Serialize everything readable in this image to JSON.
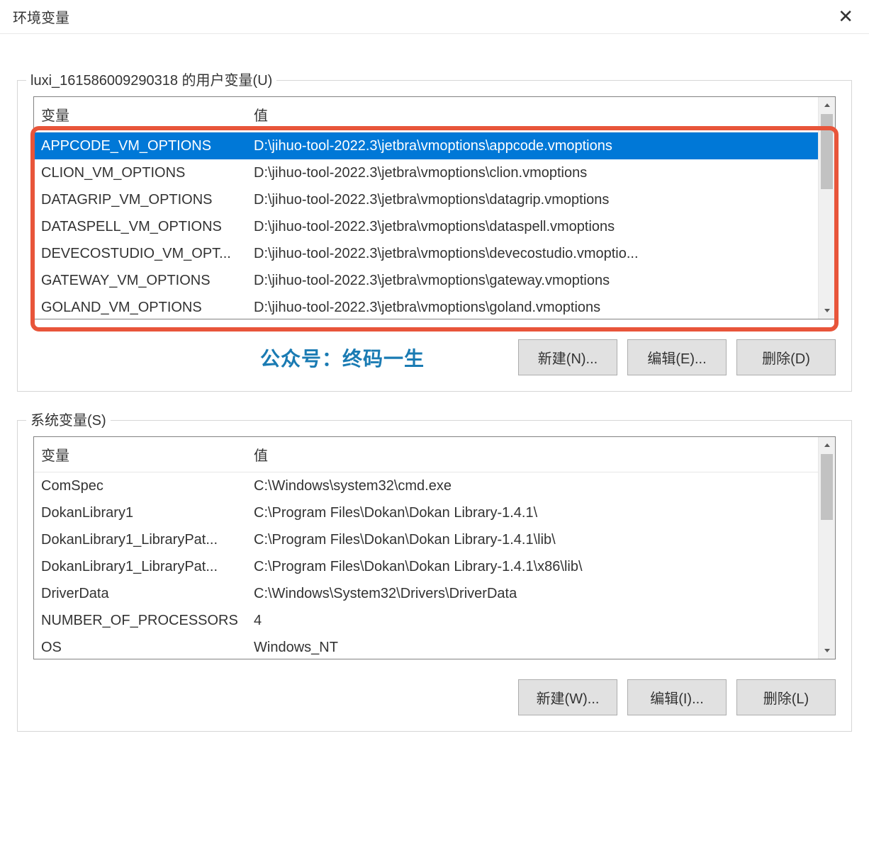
{
  "title": "环境变量",
  "user_section": {
    "legend": "luxi_161586009290318 的用户变量(U)",
    "columns": {
      "var": "变量",
      "val": "值"
    },
    "rows": [
      {
        "var": "APPCODE_VM_OPTIONS",
        "val": "D:\\jihuo-tool-2022.3\\jetbra\\vmoptions\\appcode.vmoptions",
        "selected": true
      },
      {
        "var": "CLION_VM_OPTIONS",
        "val": "D:\\jihuo-tool-2022.3\\jetbra\\vmoptions\\clion.vmoptions"
      },
      {
        "var": "DATAGRIP_VM_OPTIONS",
        "val": "D:\\jihuo-tool-2022.3\\jetbra\\vmoptions\\datagrip.vmoptions"
      },
      {
        "var": "DATASPELL_VM_OPTIONS",
        "val": "D:\\jihuo-tool-2022.3\\jetbra\\vmoptions\\dataspell.vmoptions"
      },
      {
        "var": "DEVECOSTUDIO_VM_OPT...",
        "val": "D:\\jihuo-tool-2022.3\\jetbra\\vmoptions\\devecostudio.vmoptio..."
      },
      {
        "var": "GATEWAY_VM_OPTIONS",
        "val": "D:\\jihuo-tool-2022.3\\jetbra\\vmoptions\\gateway.vmoptions"
      },
      {
        "var": "GOLAND_VM_OPTIONS",
        "val": "D:\\jihuo-tool-2022.3\\jetbra\\vmoptions\\goland.vmoptions"
      }
    ],
    "buttons": {
      "new": "新建(N)...",
      "edit": "编辑(E)...",
      "delete": "删除(D)"
    }
  },
  "system_section": {
    "legend": "系统变量(S)",
    "columns": {
      "var": "变量",
      "val": "值"
    },
    "rows": [
      {
        "var": "ComSpec",
        "val": "C:\\Windows\\system32\\cmd.exe"
      },
      {
        "var": "DokanLibrary1",
        "val": "C:\\Program Files\\Dokan\\Dokan Library-1.4.1\\"
      },
      {
        "var": "DokanLibrary1_LibraryPat...",
        "val": "C:\\Program Files\\Dokan\\Dokan Library-1.4.1\\lib\\"
      },
      {
        "var": "DokanLibrary1_LibraryPat...",
        "val": "C:\\Program Files\\Dokan\\Dokan Library-1.4.1\\x86\\lib\\"
      },
      {
        "var": "DriverData",
        "val": "C:\\Windows\\System32\\Drivers\\DriverData"
      },
      {
        "var": "NUMBER_OF_PROCESSORS",
        "val": "4"
      },
      {
        "var": "OS",
        "val": "Windows_NT"
      }
    ],
    "buttons": {
      "new": "新建(W)...",
      "edit": "编辑(I)...",
      "delete": "删除(L)"
    }
  },
  "watermark": "公众号：终码一生"
}
